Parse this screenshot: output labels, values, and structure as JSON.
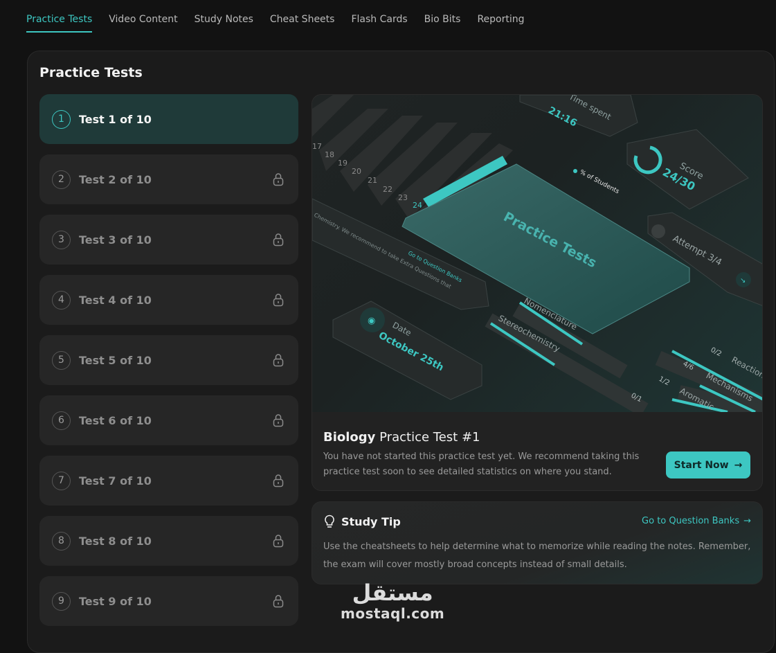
{
  "nav": {
    "tabs": [
      {
        "label": "Practice Tests"
      },
      {
        "label": "Video Content"
      },
      {
        "label": "Study Notes"
      },
      {
        "label": "Cheat Sheets"
      },
      {
        "label": "Flash Cards"
      },
      {
        "label": "Bio Bits"
      },
      {
        "label": "Reporting"
      }
    ],
    "active_tab": "Practice Tests"
  },
  "panel": {
    "title": "Practice Tests"
  },
  "tests": [
    {
      "number": "1",
      "label": "Test 1 of 10",
      "locked": false,
      "active": true
    },
    {
      "number": "2",
      "label": "Test 2 of 10",
      "locked": true
    },
    {
      "number": "3",
      "label": "Test 3 of 10",
      "locked": true
    },
    {
      "number": "4",
      "label": "Test 4 of 10",
      "locked": true
    },
    {
      "number": "5",
      "label": "Test 5 of 10",
      "locked": true
    },
    {
      "number": "6",
      "label": "Test 6 of 10",
      "locked": true
    },
    {
      "number": "7",
      "label": "Test 7 of 10",
      "locked": true
    },
    {
      "number": "8",
      "label": "Test 8 of 10",
      "locked": true
    },
    {
      "number": "9",
      "label": "Test 9 of 10",
      "locked": true
    }
  ],
  "hero": {
    "time_value": "21:16",
    "time_label": "Time spent",
    "score_label": "Score",
    "score_value": "24/30",
    "students_label": "% of Students",
    "attempt_label": "Attempt 3/4",
    "card_title": "Practice Tests",
    "date_label": "Date",
    "date_value": "October 25th",
    "question_link": "Go to Question Banks",
    "note_text": "Chemistry. We recommend to take Extra Questions that",
    "axis_numbers": [
      "17",
      "18",
      "19",
      "20",
      "21",
      "22",
      "23",
      "24"
    ],
    "topics": [
      "Nomenclature",
      "Stereochemistry",
      "Reactions",
      "Mechanisms",
      "Aromatic"
    ],
    "fractions": [
      "0/2",
      "4/6",
      "1/2",
      "0/1"
    ]
  },
  "card": {
    "subject": "Biology",
    "title_rest": "Practice Test #1",
    "description": "You have not started this practice test yet. We recommend taking this practice test soon to see detailed statistics on where you stand.",
    "start_label": "Start Now"
  },
  "tip": {
    "title": "Study Tip",
    "link": "Go to Question Banks",
    "text": "Use the cheatsheets to help determine what to memorize while reading the notes. Remember, the exam will cover mostly broad concepts instead of small details."
  },
  "watermark": {
    "arabic": "مستقل",
    "latin": "mostaql.com"
  },
  "colors": {
    "accent": "#3dc7c2",
    "panel": "#1b1b1b",
    "item": "#262626",
    "item_active": "#1f3a39"
  }
}
